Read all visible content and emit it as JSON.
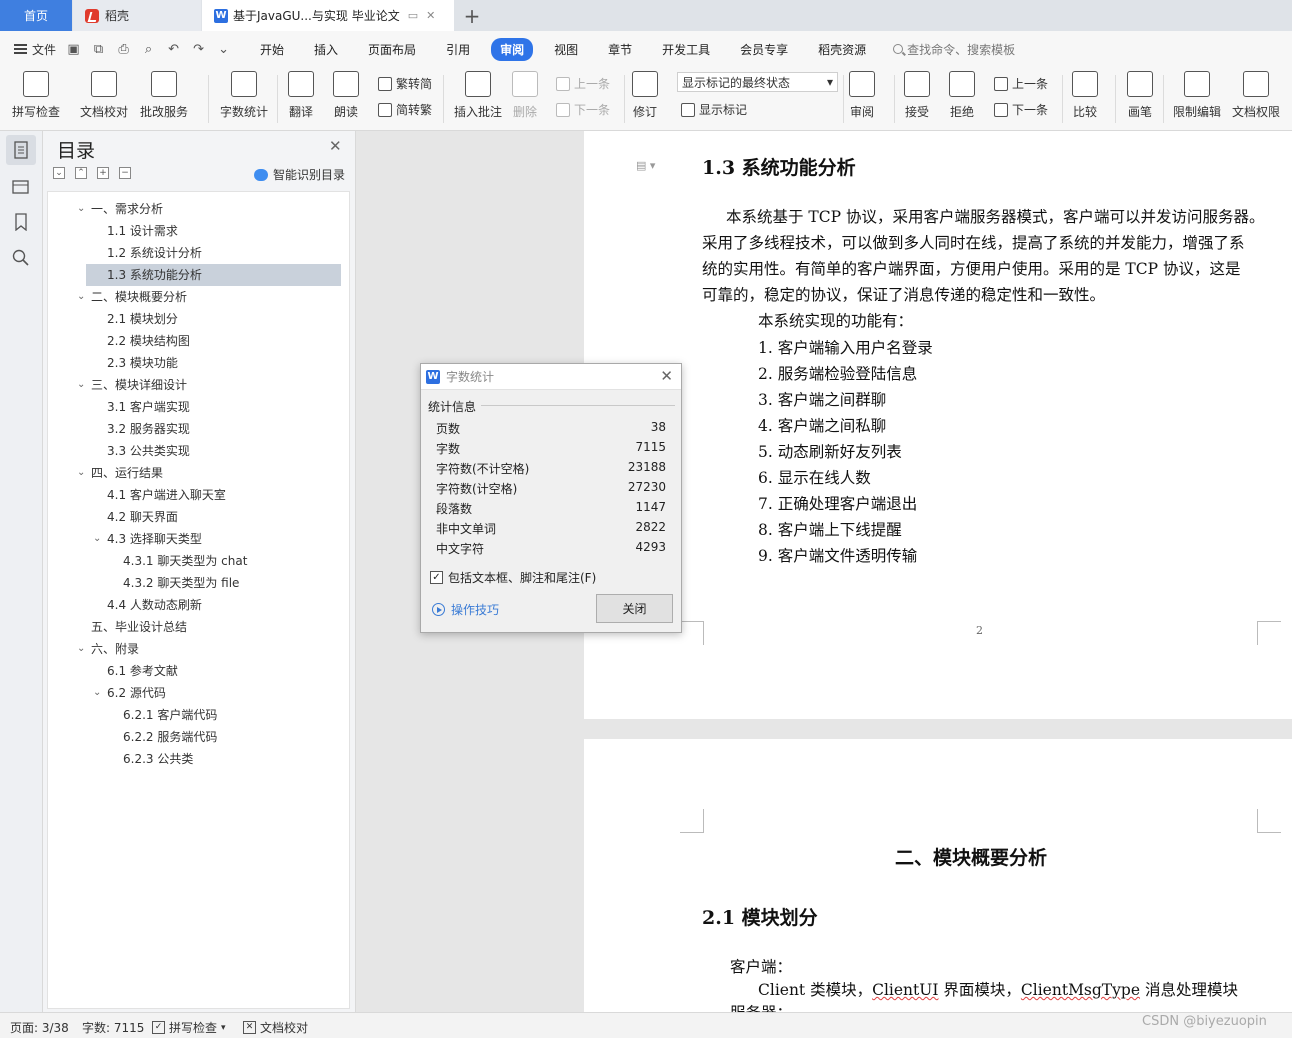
{
  "tabs": {
    "home": "首页",
    "daoke": "稻壳",
    "doc": "基于JavaGU...与实现 毕业论文",
    "add": "+"
  },
  "menu": {
    "file": "文件",
    "items": [
      "开始",
      "插入",
      "页面布局",
      "引用",
      "审阅",
      "视图",
      "章节",
      "开发工具",
      "会员专享",
      "稻壳资源"
    ],
    "active": "审阅",
    "search_placeholder": "查找命令、搜索模板"
  },
  "ribbon": {
    "spellcheck": "拼写检查",
    "doc_proof": "文档校对",
    "annot_service": "批改服务",
    "word_count": "字数统计",
    "translate": "翻译",
    "read_aloud": "朗读",
    "trad": "繁转简",
    "simp": "简转繁",
    "insert_comment": "插入批注",
    "delete": "删除",
    "prev_comment": "上一条",
    "next_comment": "下一条",
    "track": "修订",
    "markup_select": "显示标记的最终状态",
    "show_markup": "显示标记",
    "review": "审阅",
    "accept": "接受",
    "reject": "拒绝",
    "prev": "上一条",
    "next": "下一条",
    "compare": "比较",
    "pen": "画笔",
    "restrict": "限制编辑",
    "doc_perm": "文档权限"
  },
  "toc": {
    "title": "目录",
    "ai_label": "智能识别目录",
    "items": [
      {
        "label": "一、需求分析",
        "level": 1,
        "caret": true
      },
      {
        "label": "1.1  设计需求",
        "level": 2
      },
      {
        "label": "1.2  系统设计分析",
        "level": 2
      },
      {
        "label": "1.3  系统功能分析",
        "level": 2,
        "selected": true
      },
      {
        "label": "二、模块概要分析",
        "level": 1,
        "caret": true
      },
      {
        "label": "2.1  模块划分",
        "level": 2
      },
      {
        "label": "2.2  模块结构图",
        "level": 2
      },
      {
        "label": "2.3  模块功能",
        "level": 2
      },
      {
        "label": "三、模块详细设计",
        "level": 1,
        "caret": true
      },
      {
        "label": "3.1  客户端实现",
        "level": 2
      },
      {
        "label": "3.2  服务器实现",
        "level": 2
      },
      {
        "label": "3.3  公共类实现",
        "level": 2
      },
      {
        "label": "四、运行结果",
        "level": 1,
        "caret": true
      },
      {
        "label": "4.1  客户端进入聊天室",
        "level": 2
      },
      {
        "label": "4.2  聊天界面",
        "level": 2
      },
      {
        "label": "4.3  选择聊天类型",
        "level": 2,
        "caret": true
      },
      {
        "label": "4.3.1  聊天类型为 chat",
        "level": 3
      },
      {
        "label": "4.3.2  聊天类型为 file",
        "level": 3
      },
      {
        "label": "4.4  人数动态刷新",
        "level": 2
      },
      {
        "label": "五、毕业设计总结",
        "level": 1
      },
      {
        "label": "六、附录",
        "level": 1,
        "caret": true
      },
      {
        "label": "6.1  参考文献",
        "level": 2
      },
      {
        "label": "6.2  源代码",
        "level": 2,
        "caret": true
      },
      {
        "label": "6.2.1 客户端代码",
        "level": 3
      },
      {
        "label": "6.2.2 服务端代码",
        "level": 3
      },
      {
        "label": "6.2.3  公共类",
        "level": 3
      }
    ]
  },
  "document": {
    "h_1_3": "1.3  系统功能分析",
    "para_lines": [
      "本系统基于 TCP 协议，采用客户端服务器模式，客户端可以并发访问服务器。",
      "采用了多线程技术，可以做到多人同时在线，提高了系统的并发能力，增强了系",
      "统的实用性。有简单的客户端界面，方便用户使用。采用的是 TCP 协议，这是",
      "可靠的，稳定的协议，保证了消息传递的稳定性和一致性。"
    ],
    "intro": "本系统实现的功能有：",
    "features": [
      "1.  客户端输入用户名登录",
      "2.  服务端检验登陆信息",
      "3.  客户端之间群聊",
      "4.  客户端之间私聊",
      "5.  动态刷新好友列表",
      "6.  显示在线人数",
      "7.  正确处理客户端退出",
      "8.  客户端上下线提醒",
      "9.  客户端文件透明传输"
    ],
    "page_number": "2",
    "h_chapter2": "二、模块概要分析",
    "h_2_1": "2.1  模块划分",
    "client_label": "客户端：",
    "client_line": {
      "p1": "Client",
      "p2": " 类模块，",
      "p3": "ClientUI",
      "p4": " 界面模块，",
      "p5": "ClientMsgType",
      "p6": " 消息处理模块"
    },
    "server_label": "服务器："
  },
  "dialog": {
    "title": "字数统计",
    "group": "统计信息",
    "rows": [
      {
        "label": "页数",
        "value": "38"
      },
      {
        "label": "字数",
        "value": "7115"
      },
      {
        "label": "字符数(不计空格)",
        "value": "23188"
      },
      {
        "label": "字符数(计空格)",
        "value": "27230"
      },
      {
        "label": "段落数",
        "value": "1147"
      },
      {
        "label": "非中文单词",
        "value": "2822"
      },
      {
        "label": "中文字符",
        "value": "4293"
      }
    ],
    "checkbox": "包括文本框、脚注和尾注(F)",
    "tips": "操作技巧",
    "close": "关闭"
  },
  "status": {
    "page": "页面: 3/38",
    "words": "字数: 7115",
    "spell": "拼写检查",
    "proof": "文档校对"
  },
  "watermark": "CSDN @biyezuopin"
}
